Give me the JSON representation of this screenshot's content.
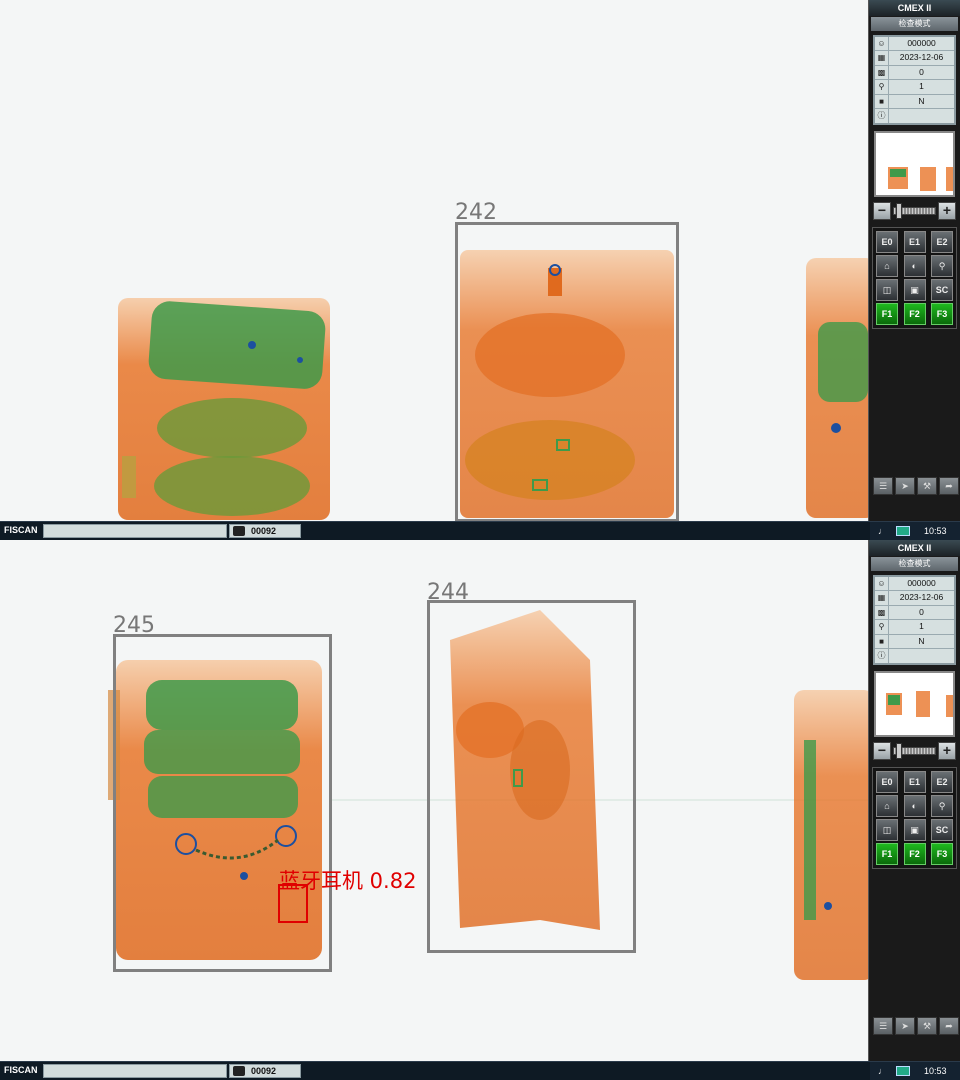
{
  "screens": [
    {
      "id": "top",
      "panel": {
        "title": "CMEX II",
        "mode": "检查模式",
        "info": [
          {
            "icon": "operator-icon",
            "value": "000000"
          },
          {
            "icon": "calendar-icon",
            "value": "2023-12-06"
          },
          {
            "icon": "counter-icon",
            "value": "0"
          },
          {
            "icon": "zoom-icon",
            "value": "1"
          },
          {
            "icon": "alarm-icon",
            "value": "N"
          },
          {
            "icon": "info-icon",
            "value": ""
          }
        ],
        "buttons": [
          "E0",
          "E1",
          "E2",
          "",
          "",
          "",
          "",
          "",
          "SC",
          "F1",
          "F2",
          "F3"
        ]
      },
      "bags": [
        {
          "label": "242"
        }
      ],
      "detections": [],
      "status": {
        "brand": "FISCAN",
        "counter": "00092",
        "time": "10:53"
      }
    },
    {
      "id": "bottom",
      "panel": {
        "title": "CMEX II",
        "mode": "检查模式",
        "info": [
          {
            "icon": "operator-icon",
            "value": "000000"
          },
          {
            "icon": "calendar-icon",
            "value": "2023-12-06"
          },
          {
            "icon": "counter-icon",
            "value": "0"
          },
          {
            "icon": "zoom-icon",
            "value": "1"
          },
          {
            "icon": "alarm-icon",
            "value": "N"
          },
          {
            "icon": "info-icon",
            "value": ""
          }
        ],
        "buttons": [
          "E0",
          "E1",
          "E2",
          "",
          "",
          "",
          "",
          "",
          "SC",
          "F1",
          "F2",
          "F3"
        ]
      },
      "bags": [
        {
          "label": "245"
        },
        {
          "label": "244"
        }
      ],
      "detections": [
        {
          "label": "蓝牙耳机 0.82"
        }
      ],
      "status": {
        "brand": "FISCAN",
        "counter": "00092",
        "time": "10:53"
      }
    }
  ],
  "colors": {
    "organic": "#e8762a",
    "inorganic": "#3f9a4a",
    "metal": "#1c4fa0",
    "detection": "#e00000",
    "bag_box": "#808080"
  }
}
